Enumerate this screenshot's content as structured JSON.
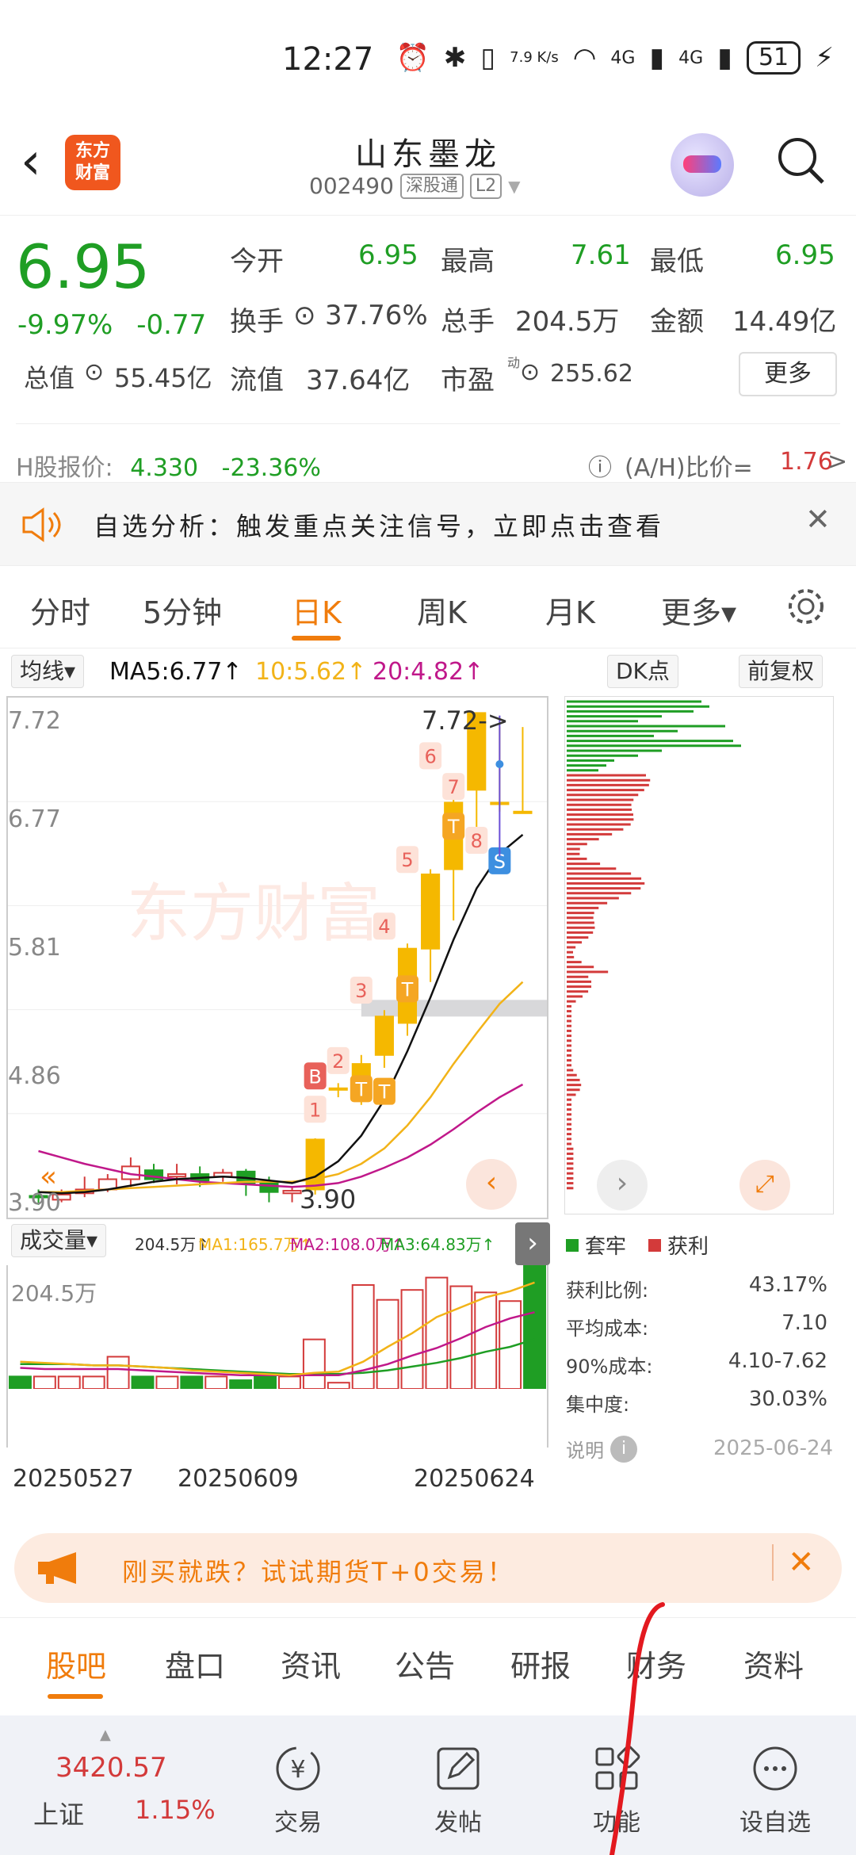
{
  "status": {
    "time": "12:27",
    "net_speed": "7.9 K/s",
    "signal1": "4G",
    "signal2": "4G",
    "battery": "51"
  },
  "header": {
    "stock_name": "山东墨龙",
    "code": "002490",
    "tag1": "深股通",
    "tag2": "L2",
    "logo": "东方\n财富"
  },
  "quote": {
    "price": "6.95",
    "pct": "-9.97%",
    "change": "-0.77",
    "open_label": "今开",
    "open": "6.95",
    "high_label": "最高",
    "high": "7.61",
    "low_label": "最低",
    "low": "6.95",
    "turnover_label": "换手",
    "turnover": "37.76%",
    "vol_label": "总手",
    "vol": "204.5万",
    "amount_label": "金额",
    "amount": "14.49亿",
    "mcap_label": "总值",
    "mcap": "55.45亿",
    "float_label": "流值",
    "float": "37.64亿",
    "pe_label": "市盈",
    "pe_sup": "动",
    "pe": "255.62",
    "more": "更多",
    "h_label": "H股报价:",
    "h_price": "4.330",
    "h_pct": "-23.36%",
    "ah_label": "(A/H)比价=",
    "ah_value": "1.76",
    "ah_arrow": ">"
  },
  "alert": {
    "text": "自选分析：触发重点关注信号，立即点击查看",
    "close": "✕"
  },
  "ktabs": [
    "分时",
    "5分钟",
    "日K",
    "周K",
    "月K",
    "更多▾"
  ],
  "mabar": {
    "button": "均线▾",
    "ma5": "MA5:6.77↑",
    "ma10": "10:5.62↑",
    "ma20": "20:4.82↑",
    "dk": "DK点",
    "fq": "前复权"
  },
  "colors": {
    "green": "#1f9e24",
    "red": "#d33a3a",
    "orange": "#f07c0c",
    "yellow": "#f5b800",
    "ma5": "#111111",
    "ma10": "#f2b318",
    "ma20": "#c0188a"
  },
  "chart": {
    "yticks": [
      "7.72",
      "6.77",
      "5.81",
      "4.86",
      "3.90"
    ],
    "label_high": "7.72->",
    "label_low": "3.90",
    "candles": [
      {
        "o": 3.95,
        "c": 3.94,
        "h": 4.0,
        "l": 3.88
      },
      {
        "o": 3.92,
        "c": 3.96,
        "h": 4.0,
        "l": 3.9
      },
      {
        "o": 3.97,
        "c": 4.0,
        "h": 4.1,
        "l": 3.94
      },
      {
        "o": 4.0,
        "c": 4.08,
        "h": 4.12,
        "l": 3.98
      },
      {
        "o": 4.08,
        "c": 4.18,
        "h": 4.25,
        "l": 4.02
      },
      {
        "o": 4.15,
        "c": 4.08,
        "h": 4.2,
        "l": 4.05
      },
      {
        "o": 4.1,
        "c": 4.12,
        "h": 4.2,
        "l": 4.04
      },
      {
        "o": 4.12,
        "c": 4.07,
        "h": 4.18,
        "l": 4.02
      },
      {
        "o": 4.1,
        "c": 4.13,
        "h": 4.16,
        "l": 4.06
      },
      {
        "o": 4.14,
        "c": 4.05,
        "h": 4.16,
        "l": 3.95
      },
      {
        "o": 4.06,
        "c": 3.98,
        "h": 4.1,
        "l": 3.9
      },
      {
        "o": 3.97,
        "c": 3.99,
        "h": 4.02,
        "l": 3.9
      },
      {
        "o": 4.0,
        "c": 4.39,
        "h": 4.4,
        "l": 3.96
      },
      {
        "o": 4.79,
        "c": 4.79,
        "h": 4.83,
        "l": 4.72
      },
      {
        "o": 4.72,
        "c": 4.98,
        "h": 5.05,
        "l": 4.66
      },
      {
        "o": 5.05,
        "c": 5.35,
        "h": 5.4,
        "l": 4.95
      },
      {
        "o": 5.3,
        "c": 5.88,
        "h": 5.92,
        "l": 5.2
      },
      {
        "o": 5.88,
        "c": 6.46,
        "h": 6.5,
        "l": 5.62
      },
      {
        "o": 6.5,
        "c": 7.02,
        "h": 7.1,
        "l": 6.1
      },
      {
        "o": 7.12,
        "c": 7.72,
        "h": 7.72,
        "l": 6.8
      },
      {
        "o": 7.02,
        "c": 7.02,
        "h": 7.61,
        "l": 6.95
      },
      {
        "o": 6.95,
        "c": 6.95,
        "h": 7.61,
        "l": 6.95
      }
    ],
    "ma5": [
      3.98,
      3.97,
      3.98,
      4.0,
      4.03,
      4.06,
      4.08,
      4.09,
      4.1,
      4.09,
      4.07,
      4.05,
      4.1,
      4.22,
      4.42,
      4.7,
      5.08,
      5.5,
      5.95,
      6.35,
      6.62,
      6.77
    ],
    "ma10": [
      3.98,
      3.98,
      3.99,
      4.0,
      4.01,
      4.02,
      4.03,
      4.04,
      4.05,
      4.06,
      4.06,
      4.06,
      4.08,
      4.12,
      4.2,
      4.32,
      4.5,
      4.72,
      4.98,
      5.22,
      5.45,
      5.62
    ],
    "ma20": [
      4.3,
      4.25,
      4.2,
      4.16,
      4.12,
      4.1,
      4.08,
      4.06,
      4.05,
      4.04,
      4.03,
      4.02,
      4.03,
      4.05,
      4.1,
      4.17,
      4.25,
      4.35,
      4.47,
      4.6,
      4.72,
      4.82
    ],
    "signals": [
      "B",
      "1",
      "2",
      "3",
      "4",
      "5",
      "6",
      "7",
      "8",
      "T",
      "T",
      "T",
      "T",
      "S"
    ]
  },
  "volbar": {
    "button": "成交量▾",
    "vol": "204.5万↑",
    "ma1": "MA1:165.7万↑",
    "ma2": "MA2:108.0万↑",
    "ma3": "MA3:64.83万↑"
  },
  "vol": {
    "ytop": "204.5万",
    "dates": [
      "20250527",
      "20250609",
      "20250624"
    ],
    "bars": [
      0.1,
      0.1,
      0.1,
      0.1,
      0.26,
      0.1,
      0.1,
      0.1,
      0.1,
      0.07,
      0.12,
      0.1,
      0.4,
      0.05,
      0.84,
      0.72,
      0.8,
      0.9,
      0.83,
      0.78,
      0.71,
      1.0
    ],
    "ma1": [
      0.22,
      0.21,
      0.2,
      0.19,
      0.19,
      0.18,
      0.17,
      0.15,
      0.14,
      0.13,
      0.12,
      0.11,
      0.13,
      0.14,
      0.22,
      0.34,
      0.45,
      0.58,
      0.66,
      0.74,
      0.79,
      0.86
    ],
    "ma2": [
      0.17,
      0.16,
      0.16,
      0.16,
      0.16,
      0.15,
      0.14,
      0.13,
      0.12,
      0.11,
      0.11,
      0.11,
      0.11,
      0.11,
      0.15,
      0.2,
      0.27,
      0.33,
      0.41,
      0.5,
      0.57,
      0.62
    ],
    "ma3": [
      0.2,
      0.2,
      0.2,
      0.19,
      0.19,
      0.18,
      0.17,
      0.16,
      0.15,
      0.14,
      0.13,
      0.12,
      0.12,
      0.12,
      0.13,
      0.15,
      0.18,
      0.21,
      0.25,
      0.3,
      0.34,
      0.4
    ]
  },
  "profit": {
    "legend_loss": "套牢",
    "legend_gain": "获利",
    "rows": [
      {
        "label": "获利比例:",
        "value": "43.17%"
      },
      {
        "label": "平均成本:",
        "value": "7.10"
      },
      {
        "label": "90%成本:",
        "value": "4.10-7.62"
      },
      {
        "label": "集中度:",
        "value": "30.03%"
      }
    ],
    "note": "说明",
    "date": "2025-06-24"
  },
  "ad": {
    "text": "刚买就跌？试试期货T+0交易！",
    "close": "✕"
  },
  "tabs2": [
    "股吧",
    "盘口",
    "资讯",
    "公告",
    "研报",
    "财务",
    "资料"
  ],
  "bottom": {
    "index_value": "3420.57",
    "index_name": "上证",
    "index_pct": "1.15%",
    "trade": "交易",
    "post": "发帖",
    "func": "功能",
    "watch": "设自选"
  }
}
